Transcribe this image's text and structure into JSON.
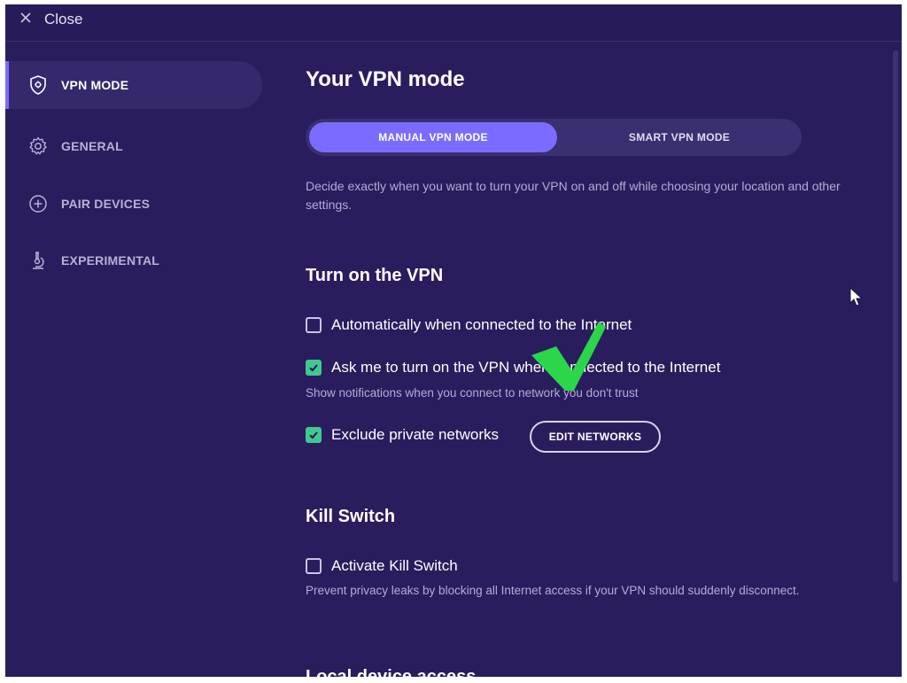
{
  "titlebar": {
    "close_label": "Close"
  },
  "sidebar": {
    "items": [
      {
        "label": "VPN MODE",
        "icon": "shield-icon",
        "active": true
      },
      {
        "label": "GENERAL",
        "icon": "gear-icon",
        "active": false
      },
      {
        "label": "PAIR DEVICES",
        "icon": "plus-circle-icon",
        "active": false
      },
      {
        "label": "EXPERIMENTAL",
        "icon": "microscope-icon",
        "active": false
      }
    ]
  },
  "main": {
    "title": "Your VPN mode",
    "mode_toggle": {
      "manual": "MANUAL VPN MODE",
      "smart": "SMART VPN MODE",
      "selected": "manual"
    },
    "mode_description": "Decide exactly when you want to turn your VPN on and off while choosing your location and other settings.",
    "turn_on": {
      "heading": "Turn on the VPN",
      "auto_label": "Automatically when connected to the Internet",
      "ask_label": "Ask me to turn on the VPN when connected to the Internet",
      "ask_checked": true,
      "ask_note": "Show notifications when you connect to network you don't trust",
      "exclude_label": "Exclude private networks",
      "exclude_checked": true,
      "edit_networks": "EDIT NETWORKS"
    },
    "kill_switch": {
      "heading": "Kill Switch",
      "activate_label": "Activate Kill Switch",
      "activate_checked": false,
      "note": "Prevent privacy leaks by blocking all Internet access if your VPN should suddenly disconnect."
    },
    "local_access": {
      "heading": "Local device access"
    }
  },
  "colors": {
    "background": "#2a1d5e",
    "accent": "#7b6cff",
    "check": "#3fc98f",
    "overlay_check": "#2bd64a"
  }
}
